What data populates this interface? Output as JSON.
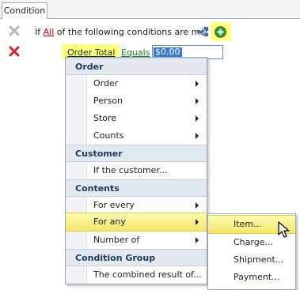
{
  "tab": {
    "label": "Condition"
  },
  "header_row": {
    "prefix": "If",
    "quantifier": "All",
    "suffix": "of the following conditions are met"
  },
  "condition_row": {
    "field": "Order Total",
    "operator": "Equals",
    "value": "$0.00"
  },
  "menu": {
    "sections": [
      {
        "header": "Order",
        "items": [
          {
            "label": "Order",
            "submenu": true
          },
          {
            "label": "Person",
            "submenu": true
          },
          {
            "label": "Store",
            "submenu": true
          },
          {
            "label": "Counts",
            "submenu": true
          }
        ]
      },
      {
        "header": "Customer",
        "items": [
          {
            "label": "If the customer...",
            "submenu": false
          }
        ]
      },
      {
        "header": "Contents",
        "items": [
          {
            "label": "For every",
            "submenu": true
          },
          {
            "label": "For any",
            "submenu": true
          },
          {
            "label": "Number of",
            "submenu": true
          }
        ]
      },
      {
        "header": "Condition Group",
        "items": [
          {
            "label": "The combined result of...",
            "submenu": false
          }
        ]
      }
    ]
  },
  "submenu": {
    "items": [
      "Item...",
      "Charge...",
      "Shipment...",
      "Payment..."
    ]
  },
  "colors": {
    "highlight": "#ffff80",
    "menu_header_bg": "#e3e9f0",
    "add_button": "#2e9a2e",
    "delete_icon": "#d42424"
  }
}
